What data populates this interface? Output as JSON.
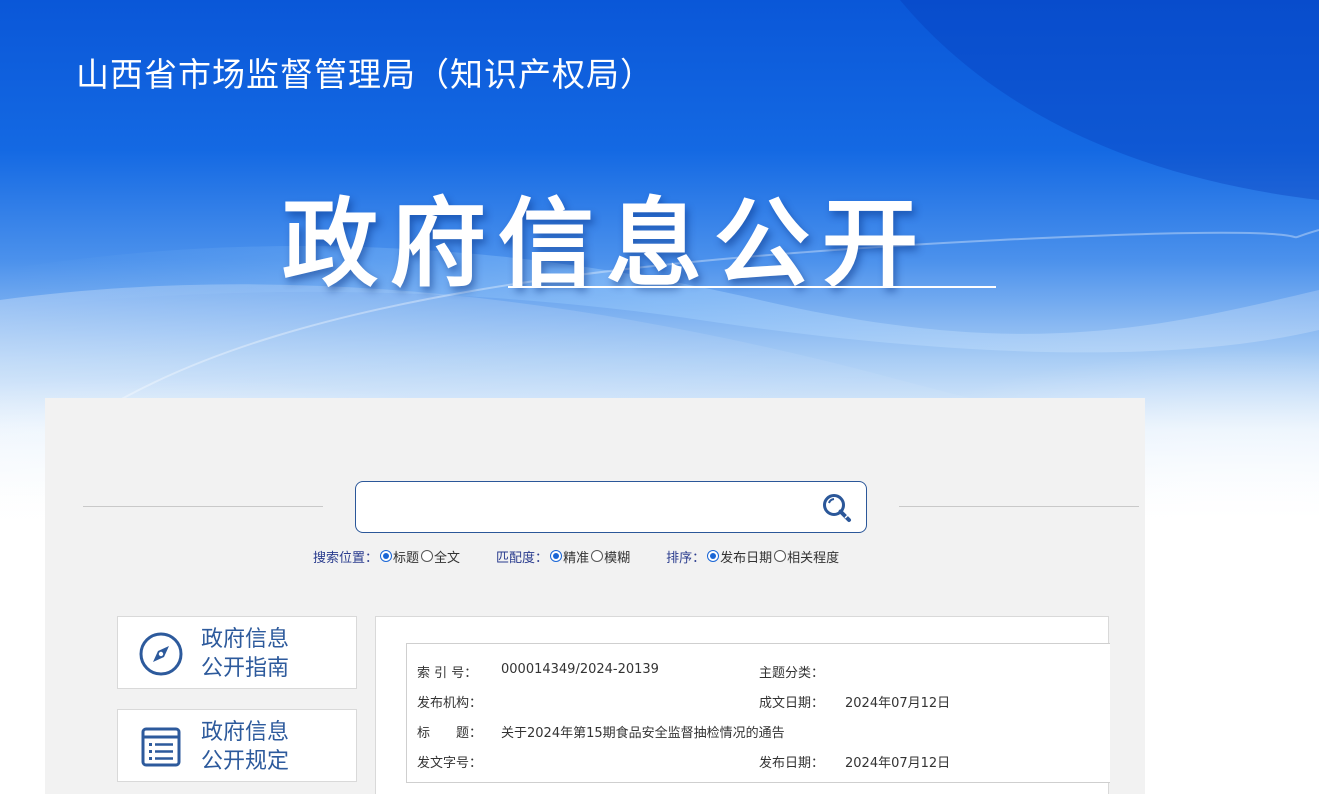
{
  "header": {
    "site_name": "山西省市场监督管理局（知识产权局）",
    "hero_title": "政府信息公开"
  },
  "colors": {
    "banner_blue": "#0a57d8",
    "accent": "#2d5a9c",
    "label_blue": "#2a3c8e",
    "radio_checked": "#1a66d6",
    "panel_bg": "#f2f2f2"
  },
  "search": {
    "value": "",
    "placeholder": "",
    "icon": "search-icon"
  },
  "search_options": {
    "position": {
      "label": "搜索位置：",
      "options": [
        "标题",
        "全文"
      ],
      "selected": "标题"
    },
    "match": {
      "label": "匹配度：",
      "options": [
        "精准",
        "模糊"
      ],
      "selected": "精准"
    },
    "sort": {
      "label": "排序：",
      "options": [
        "发布日期",
        "相关程度"
      ],
      "selected": "发布日期"
    }
  },
  "sidebar": {
    "items": [
      {
        "line1": "政府信息",
        "line2": "公开指南",
        "icon": "compass-icon"
      },
      {
        "line1": "政府信息",
        "line2": "公开规定",
        "icon": "document-list-icon"
      }
    ]
  },
  "meta": {
    "index_no_label": "索 引 号：",
    "index_no": "000014349/2024-20139",
    "topic_label": "主题分类：",
    "topic": "",
    "publisher_label": "发布机构：",
    "publisher": "",
    "written_date_label": "成文日期：",
    "written_date": "2024年07月12日",
    "title_label": "标　　题：",
    "title": "关于2024年第15期食品安全监督抽检情况的通告",
    "doc_no_label": "发文字号：",
    "doc_no": "",
    "publish_date_label": "发布日期：",
    "publish_date": "2024年07月12日"
  }
}
